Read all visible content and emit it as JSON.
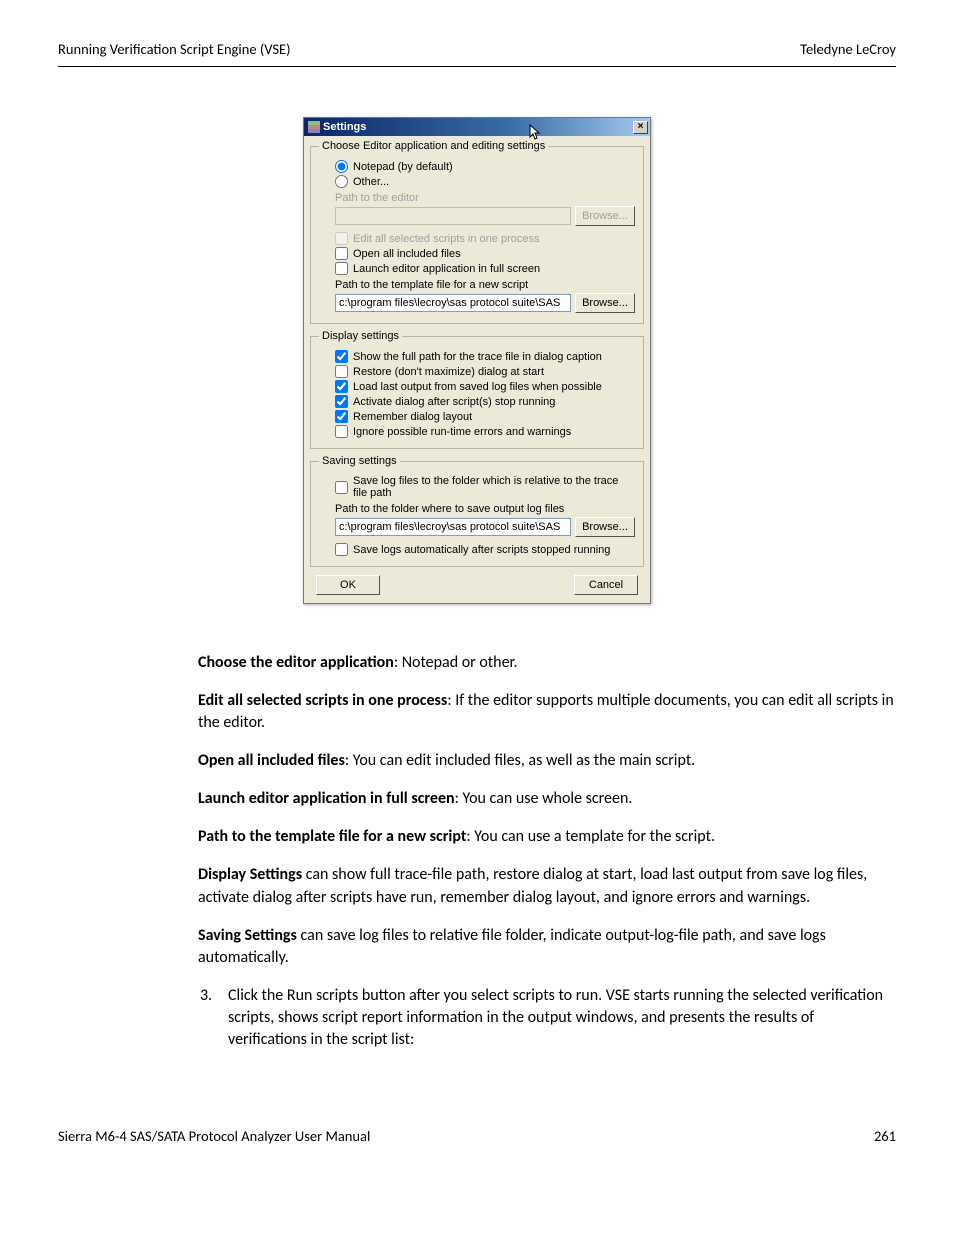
{
  "header": {
    "left": "Running Verification Script Engine (VSE)",
    "right": "Teledyne LeCroy"
  },
  "dialog": {
    "title": "Settings",
    "close_glyph": "×",
    "group_editor": {
      "legend": "Choose Editor application and editing settings",
      "radio_notepad": "Notepad (by default)",
      "radio_other": "Other...",
      "path_label": "Path to the editor",
      "path_value": "",
      "browse1": "Browse...",
      "chk_edit_all": "Edit all selected scripts in one process",
      "chk_open_all": "Open all included files",
      "chk_fullscreen": "Launch editor application in full screen",
      "template_label": "Path to the template file for a new script",
      "template_value": "c:\\program files\\lecroy\\sas protocol suite\\SAS",
      "browse2": "Browse..."
    },
    "group_display": {
      "legend": "Display settings",
      "chk_fullpath": "Show the full path for the trace file in dialog caption",
      "chk_restore": "Restore (don't maximize) dialog at start",
      "chk_loadlast": "Load last output from saved log files when possible",
      "chk_activate": "Activate dialog after script(s) stop running",
      "chk_remember": "Remember dialog layout",
      "chk_ignore": "Ignore possible run-time errors and warnings"
    },
    "group_saving": {
      "legend": "Saving settings",
      "chk_relative": "Save log files to the folder which is relative to the trace file path",
      "folder_label": "Path to the folder where to save output log files",
      "folder_value": "c:\\program files\\lecroy\\sas protocol suite\\SAS",
      "browse3": "Browse...",
      "chk_autosave": "Save logs automatically after scripts stopped running"
    },
    "ok": "OK",
    "cancel": "Cancel"
  },
  "body": {
    "p1a": "Choose the editor application",
    "p1b": ": Notepad or other.",
    "p2a": "Edit all selected scripts in one process",
    "p2b": ": If the editor supports multiple documents, you can edit all scripts in the editor.",
    "p3a": "Open all included files",
    "p3b": ": You can edit included files, as well as the main script.",
    "p4a": "Launch editor application in full screen",
    "p4b": ": You can use whole screen.",
    "p5a": "Path to the template file for a new script",
    "p5b": ": You can use a template for the script.",
    "p6a": "Display Settings",
    "p6b": " can show full trace-file path, restore dialog at start, load last output from save log files, activate dialog after scripts have run, remember dialog layout, and ignore errors and warnings.",
    "p7a": "Saving Settings",
    "p7b": " can save log files to relative file folder, indicate output-log-file path, and save logs automatically.",
    "li3_pre": "Click the ",
    "li3_bold": "Run scripts",
    "li3_post": " button after you select scripts to run. VSE starts running the selected verification scripts, shows script report information in the output windows, and presents the results of verifications in the script list:"
  },
  "footer": {
    "left": "Sierra M6-4 SAS/SATA Protocol Analyzer User Manual",
    "right": "261"
  }
}
